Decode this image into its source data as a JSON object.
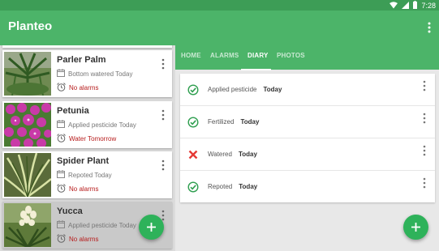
{
  "status_bar": {
    "time": "7:28"
  },
  "app_bar": {
    "title": "Planteo"
  },
  "plants": [
    {
      "name": "Parler Palm",
      "last_action": "Bottom watered Today",
      "alarm": "No alarms",
      "selected": false
    },
    {
      "name": "Petunia",
      "last_action": "Applied pesticide Today",
      "alarm": "Water Tomorrow",
      "selected": false
    },
    {
      "name": "Spider Plant",
      "last_action": "Repoted Today",
      "alarm": "No alarms",
      "selected": false
    },
    {
      "name": "Yucca",
      "last_action": "Applied pesticide Today",
      "alarm": "No alarms",
      "selected": true
    }
  ],
  "tabs": [
    {
      "label": "HOME",
      "active": false
    },
    {
      "label": "ALARMS",
      "active": false
    },
    {
      "label": "DIARY",
      "active": true
    },
    {
      "label": "PHOTOS",
      "active": false
    }
  ],
  "diary": [
    {
      "action": "Applied pesticide",
      "when": "Today",
      "status": "done"
    },
    {
      "action": "Fertilized",
      "when": "Today",
      "status": "done"
    },
    {
      "action": "Watered",
      "when": "Today",
      "status": "missed"
    },
    {
      "action": "Repoted",
      "when": "Today",
      "status": "done"
    }
  ],
  "colors": {
    "primary": "#4cb469",
    "status_bar": "#3d9d56",
    "accent": "#2eb25a",
    "alarm_text": "#b71c1c",
    "missed": "#e53935"
  }
}
